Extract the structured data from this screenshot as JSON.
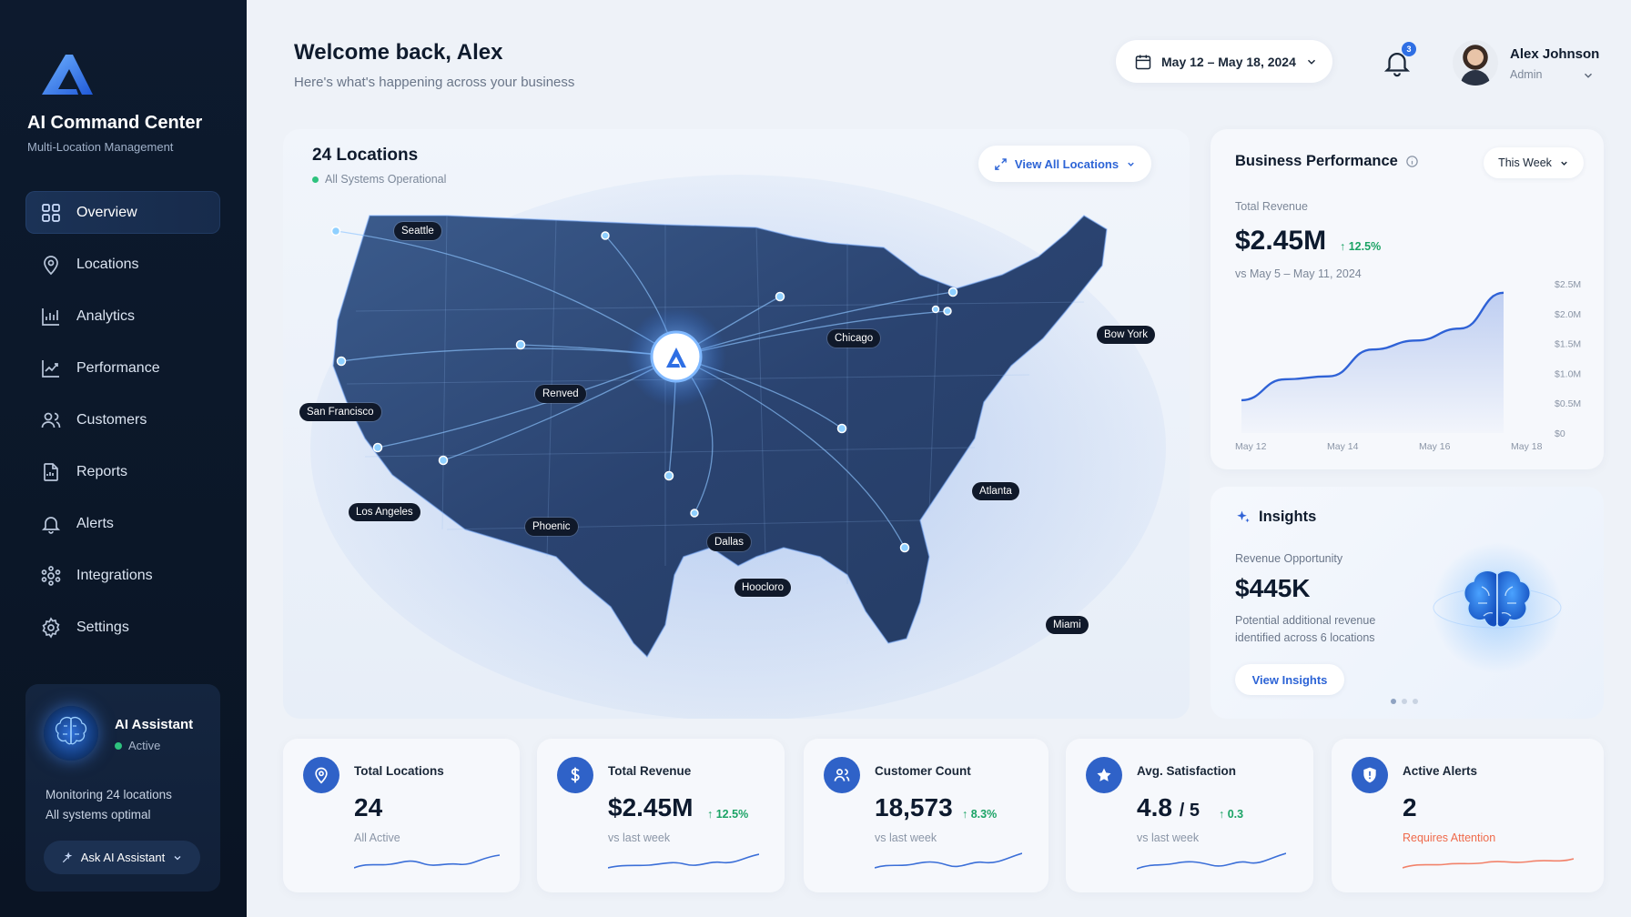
{
  "sidebar": {
    "brand_title": "AI Command Center",
    "brand_subtitle": "Multi-Location Management",
    "items": [
      {
        "label": "Overview",
        "icon": "grid-icon"
      },
      {
        "label": "Locations",
        "icon": "map-pin-icon"
      },
      {
        "label": "Analytics",
        "icon": "bar-chart-icon"
      },
      {
        "label": "Performance",
        "icon": "line-chart-icon"
      },
      {
        "label": "Customers",
        "icon": "users-icon"
      },
      {
        "label": "Reports",
        "icon": "report-icon"
      },
      {
        "label": "Alerts",
        "icon": "bell-icon"
      },
      {
        "label": "Integrations",
        "icon": "integrations-icon"
      },
      {
        "label": "Settings",
        "icon": "gear-icon"
      }
    ],
    "assistant": {
      "name": "AI Assistant",
      "status": "Active",
      "line1": "Monitoring 24 locations",
      "line2": "All systems optimal",
      "button": "Ask AI Assistant"
    }
  },
  "header": {
    "welcome": "Welcome back, Alex",
    "subtitle": "Here's what's happening across your business",
    "date_range": "May 12 – May 18, 2024",
    "notifications": "3",
    "user_name": "Alex Johnson",
    "user_role": "Admin"
  },
  "map": {
    "title": "24 Locations",
    "status": "All Systems Operational",
    "view_all": "View All Locations",
    "cities": [
      "Seattle",
      "Chicago",
      "Bow York",
      "San Francisco",
      "Renved",
      "Los Angeles",
      "Phoenic",
      "Dallas",
      "Atlanta",
      "Hoocloro",
      "Miami"
    ]
  },
  "performance": {
    "title": "Business Performance",
    "period": "This Week",
    "label": "Total Revenue",
    "value": "$2.45M",
    "change": "12.5%",
    "compare": "vs May 5 – May 11, 2024",
    "y_ticks": [
      "$0",
      "$0.5M",
      "$1.0M",
      "$1.5M",
      "$2.0M",
      "$2.5M"
    ],
    "x_ticks": [
      "May 12",
      "May 14",
      "May 16",
      "May 18"
    ]
  },
  "chart_data": {
    "type": "area",
    "x": [
      "May 12",
      "May 13",
      "May 14",
      "May 15",
      "May 16",
      "May 17",
      "May 18"
    ],
    "values": [
      0.55,
      0.9,
      0.95,
      1.4,
      1.55,
      1.75,
      2.35
    ],
    "ylim": [
      0,
      2.5
    ],
    "grid": false,
    "color": "#2f62d6"
  },
  "insights": {
    "title": "Insights",
    "label": "Revenue Opportunity",
    "value": "$445K",
    "desc1": "Potential additional revenue",
    "desc2": "identified across 6 locations",
    "button": "View Insights"
  },
  "stats": [
    {
      "title": "Total Locations",
      "value": "24",
      "change": "",
      "sub": "All Active",
      "icon": "map-pin-icon"
    },
    {
      "title": "Total Revenue",
      "value": "$2.45M",
      "change": "12.5%",
      "sub": "vs last week",
      "icon": "dollar-icon"
    },
    {
      "title": "Customer Count",
      "value": "18,573",
      "change": "8.3%",
      "sub": "vs last week",
      "icon": "users-icon"
    },
    {
      "title": "Avg. Satisfaction",
      "value": "4.8",
      "suffix": "/ 5",
      "change": "0.3",
      "sub": "vs last week",
      "icon": "star-icon"
    },
    {
      "title": "Active Alerts",
      "value": "2",
      "change": "",
      "sub": "Requires Attention",
      "icon": "shield-icon"
    }
  ],
  "colors": {
    "accent": "#2f62c8",
    "positive": "#1ba365",
    "warning": "#ef6a4b",
    "sidebar_bg": "#0d1a2e"
  }
}
